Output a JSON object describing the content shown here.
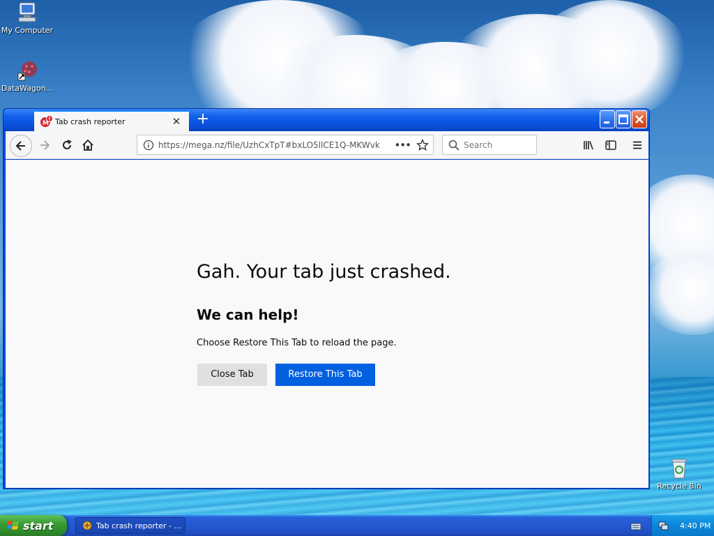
{
  "desktop": {
    "icons": [
      {
        "label": "My Computer"
      },
      {
        "label": "DataWagon..."
      },
      {
        "label": "Recycle Bin"
      }
    ]
  },
  "browser": {
    "tab_title": "Tab crash reporter",
    "url": "https://mega.nz/file/UzhCxTpT#bxLO5llCE1Q-MKWvk",
    "search_placeholder": "Search"
  },
  "crash_page": {
    "title": "Gah. Your tab just crashed.",
    "subtitle": "We can help!",
    "message": "Choose Restore This Tab to reload the page.",
    "close_button": "Close Tab",
    "restore_button": "Restore This Tab"
  },
  "taskbar": {
    "start_label": "start",
    "task_label": "Tab crash reporter - ...",
    "clock": "4:40 PM"
  },
  "colors": {
    "accent": "#0060df",
    "xp_blue": "#0a49d6",
    "start_green": "#3a9e35"
  }
}
